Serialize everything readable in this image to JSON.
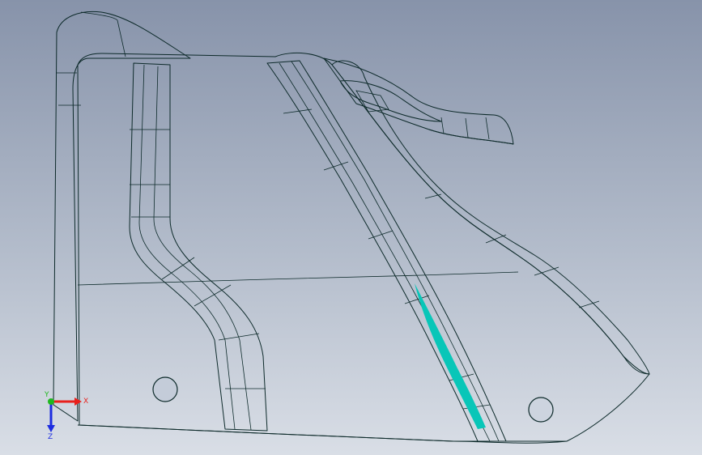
{
  "axis_triad": {
    "x_label": "X",
    "y_label": "Y",
    "z_label": "Z",
    "x_color": "#e8201c",
    "y_color": "#1fb81f",
    "z_color": "#1c2ce0"
  },
  "colors": {
    "background_top": "#8793aa",
    "background_bottom": "#d9dee6",
    "part_surface_top": "#0ff0e0",
    "part_surface_light": "#c6fdfb",
    "part_edge": "#0d2a2a"
  },
  "holes": [
    {
      "name": "mounting-hole-left"
    },
    {
      "name": "mounting-hole-right"
    }
  ]
}
